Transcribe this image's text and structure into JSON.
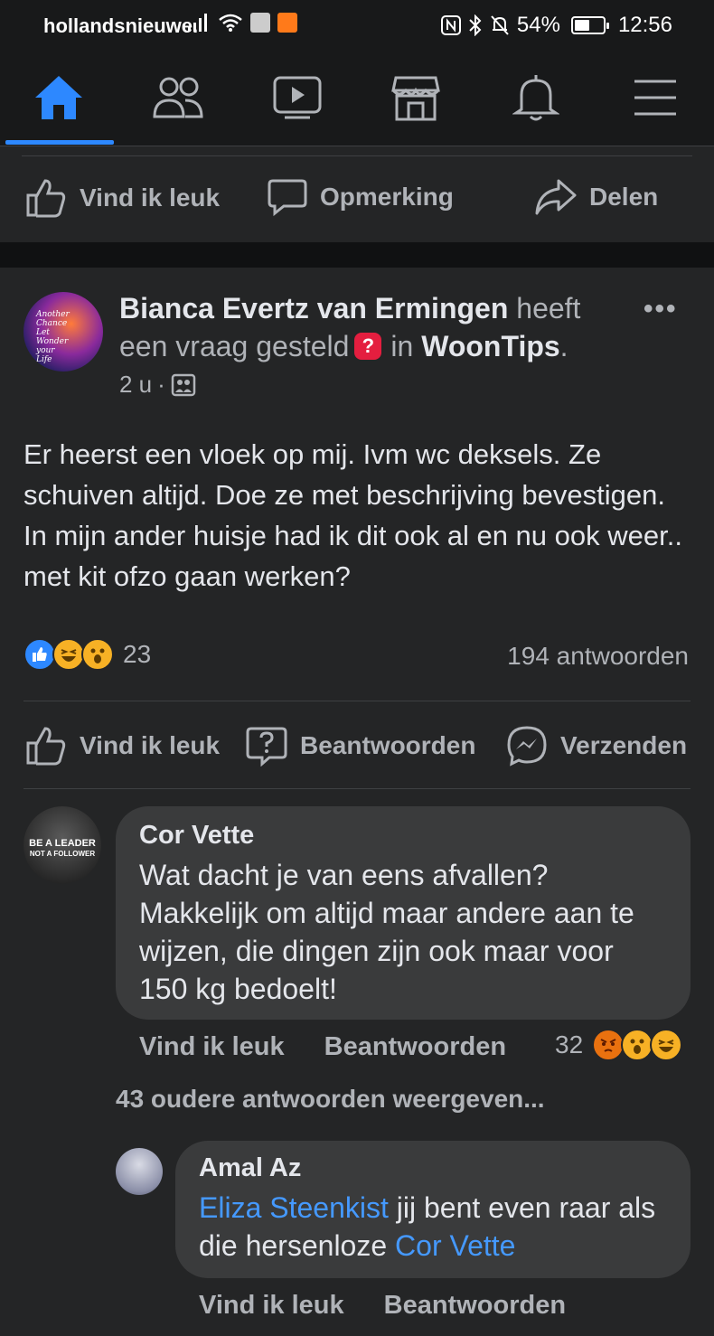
{
  "status_bar": {
    "carrier": "hollandsnieuwe.",
    "battery": "54%",
    "battery_level": 0.54,
    "time": "12:56"
  },
  "nav": {
    "tabs": [
      "home-icon",
      "friends-icon",
      "watch-icon",
      "marketplace-icon",
      "notifications-icon",
      "menu-icon"
    ],
    "active": "home",
    "accent": "#2d88ff"
  },
  "previous_post_actions": {
    "like": "Vind ik leuk",
    "comment": "Opmerking",
    "share": "Delen"
  },
  "post": {
    "author": "Bianca Evertz van Ermingen",
    "asked_text": "heeft een vraag gesteld",
    "in_text": "in",
    "group": "WoonTips",
    "time": "2 u",
    "body": "Er heerst een vloek op mij. Ivm wc deksels. Ze schuiven altijd. Doe ze met beschrijving bevestigen. In mijn ander huisje had ik dit ook al en nu ook weer.. met kit ofzo gaan werken?",
    "reaction_count": "23",
    "answers": "194 antwoorden",
    "actions": {
      "like": "Vind ik leuk",
      "answer": "Beantwoorden",
      "send": "Verzenden"
    },
    "avatar_text": [
      "Another",
      "Chance",
      "Let",
      "Wonder",
      "your",
      "Life"
    ]
  },
  "comments": [
    {
      "name": "Cor Vette",
      "text": "Wat dacht je van eens afvallen? Makkelijk om altijd maar andere aan te wijzen, die dingen zijn ook maar voor 150 kg bedoelt!",
      "like": "Vind ik leuk",
      "reply": "Beantwoorden",
      "reactions": "32",
      "avatar_text": [
        "BE A LEADER",
        "NOT A FOLLOWER"
      ]
    }
  ],
  "older_replies": "43 oudere antwoorden weergeven...",
  "reply": {
    "name": "Amal Az",
    "mention1": "Eliza Steenkist",
    "text_mid": "jij bent even raar als die hersenloze",
    "mention2": "Cor Vette",
    "like": "Vind ik leuk",
    "reply": "Beantwoorden"
  }
}
